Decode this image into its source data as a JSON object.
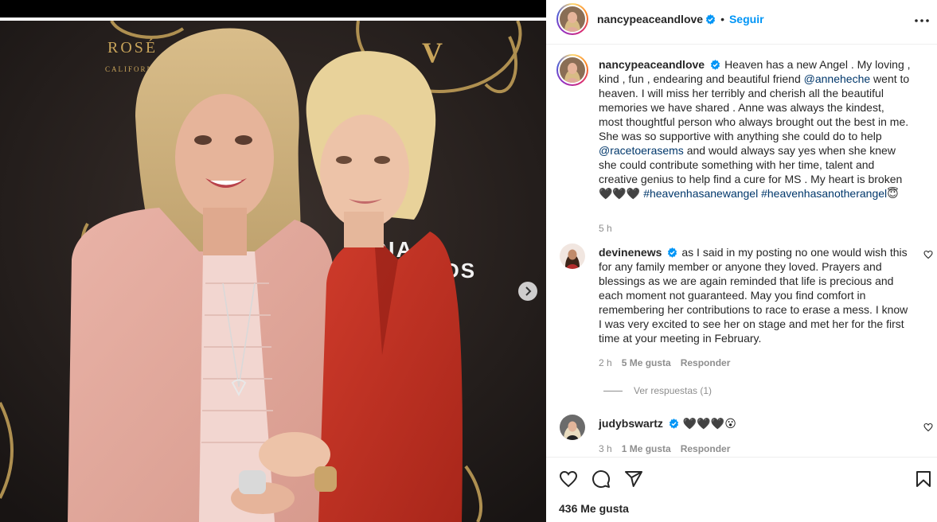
{
  "post": {
    "username": "nancypeaceandlove",
    "follow_label": "Seguir",
    "caption_parts": {
      "p1": "Heaven has a new Angel . My loving , kind , fun , endearing and beautiful friend ",
      "mention1": "@anneheche",
      "p2": " went to heaven. I will miss her terribly and cherish all the beautiful memories we have shared . Anne was always the kindest, most thoughtful person who always brought out the best in me. She was so supportive with anything she could do to help ",
      "mention2": "@racetoerasems",
      "p3": " and would always say yes when she knew she could contribute something with her time, talent and creative genius to help find a cure for MS . My heart is broken 🖤🖤🖤 ",
      "tag1": "#heavenhasanewangel",
      "tag2": "#heavenhasanotherangel",
      "end": "😇"
    },
    "time": "5 h",
    "likes": "436 Me gusta",
    "photo_text": {
      "rose": "ROSÉ",
      "california": "CALIFORNIA",
      "media1": "EDIA",
      "media2": "DS",
      "sign_v": "V"
    }
  },
  "comments": [
    {
      "username": "devinenews",
      "text": "as I said in my posting no one would wish this for any family member or anyone they loved. Prayers and blessings as we are again reminded that life is precious and each moment not guaranteed. May you find comfort in remembering her contributions to race to erase a mess. I know I was very excited to see her on stage and met her for the first time at your meeting in February.",
      "time": "2 h",
      "likes": "5 Me gusta",
      "reply": "Responder",
      "view_replies": "Ver respuestas (1)"
    },
    {
      "username": "judybswartz",
      "text": "🖤🖤🖤😮",
      "time": "3 h",
      "likes": "1 Me gusta",
      "reply": "Responder"
    }
  ],
  "icons": {
    "verified": "verified-badge-icon",
    "more": "more-options-icon",
    "heart": "heart-icon",
    "comment": "comment-icon",
    "share": "share-icon",
    "save": "bookmark-icon",
    "next": "chevron-right-icon"
  },
  "colors": {
    "accent": "#0095f6",
    "mention": "#00376b",
    "muted": "#8e8e8e",
    "text": "#262626"
  }
}
